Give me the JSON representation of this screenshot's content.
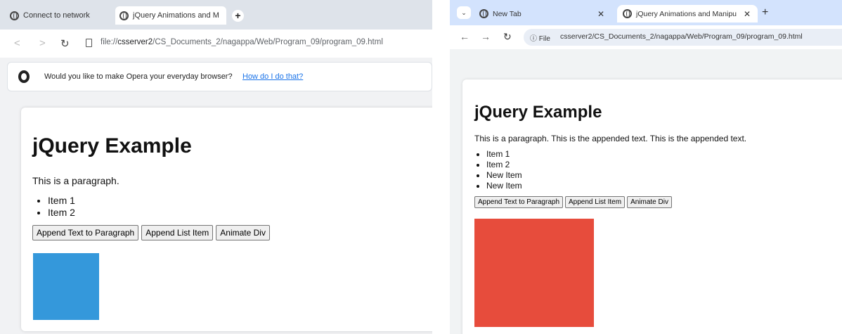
{
  "left": {
    "tabs": [
      {
        "title": "Connect to network",
        "active": false
      },
      {
        "title": "jQuery Animations and M",
        "active": true
      }
    ],
    "new_tab_label": "+",
    "url": {
      "prefix": "file://",
      "host": "csserver2",
      "path": "/CS_Documents_2/nagappa/Web/Program_09/program_09.html"
    },
    "infobar": {
      "text": "Would you like to make Opera your everyday browser?",
      "link": "How do I do that?"
    },
    "page": {
      "heading": "jQuery Example",
      "paragraph": "This is a paragraph.",
      "list_items": [
        "Item 1",
        "Item 2"
      ],
      "buttons": [
        "Append Text to Paragraph",
        "Append List Item",
        "Animate Div"
      ],
      "box_color": "#3498db"
    }
  },
  "right": {
    "tab_list_label": "⌄",
    "tabs": [
      {
        "title": "New Tab",
        "active": false,
        "close_label": "✕"
      },
      {
        "title": "jQuery Animations and Manipu",
        "active": true,
        "close_label": "✕"
      }
    ],
    "new_tab_label": "+",
    "security_chip": "File",
    "url": "csserver2/CS_Documents_2/nagappa/Web/Program_09/program_09.html",
    "page": {
      "heading": "jQuery Example",
      "paragraph": "This is a paragraph. This is the appended text. This is the appended text.",
      "list_items": [
        "Item 1",
        "Item 2",
        "New Item",
        "New Item"
      ],
      "buttons": [
        "Append Text to Paragraph",
        "Append List Item",
        "Animate Div"
      ],
      "box_color": "#e74c3c"
    }
  },
  "icons": {
    "back": "back-arrow-icon",
    "forward": "forward-arrow-icon",
    "reload": "reload-icon"
  }
}
